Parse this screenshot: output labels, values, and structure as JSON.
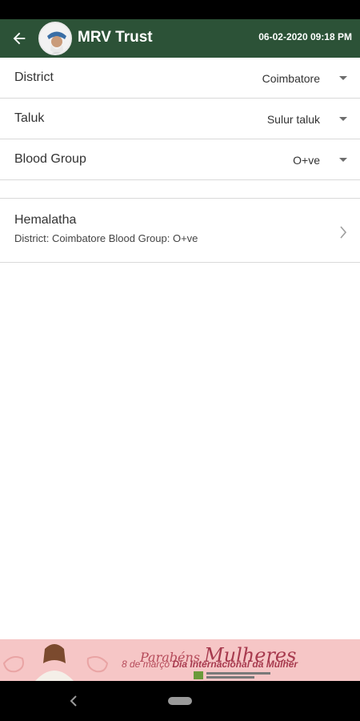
{
  "app_bar": {
    "title": "MRV Trust",
    "datetime": "06-02-2020 09:18 PM",
    "back_icon": "arrow-back-icon",
    "color": "#2c5237"
  },
  "filters": [
    {
      "label": "District",
      "value": "Coimbatore"
    },
    {
      "label": "Taluk",
      "value": "Sulur taluk"
    },
    {
      "label": "Blood Group",
      "value": "O+ve"
    }
  ],
  "results": [
    {
      "name": "Hemalatha",
      "detail": "District: Coimbatore Blood Group: O+ve"
    }
  ],
  "ad": {
    "title": "Parabéns",
    "title_script": "Mulheres",
    "subtitle_prefix": "8 de março",
    "subtitle_bold": "Dia Internacional da Mulher",
    "background": "#f6c6c6"
  }
}
